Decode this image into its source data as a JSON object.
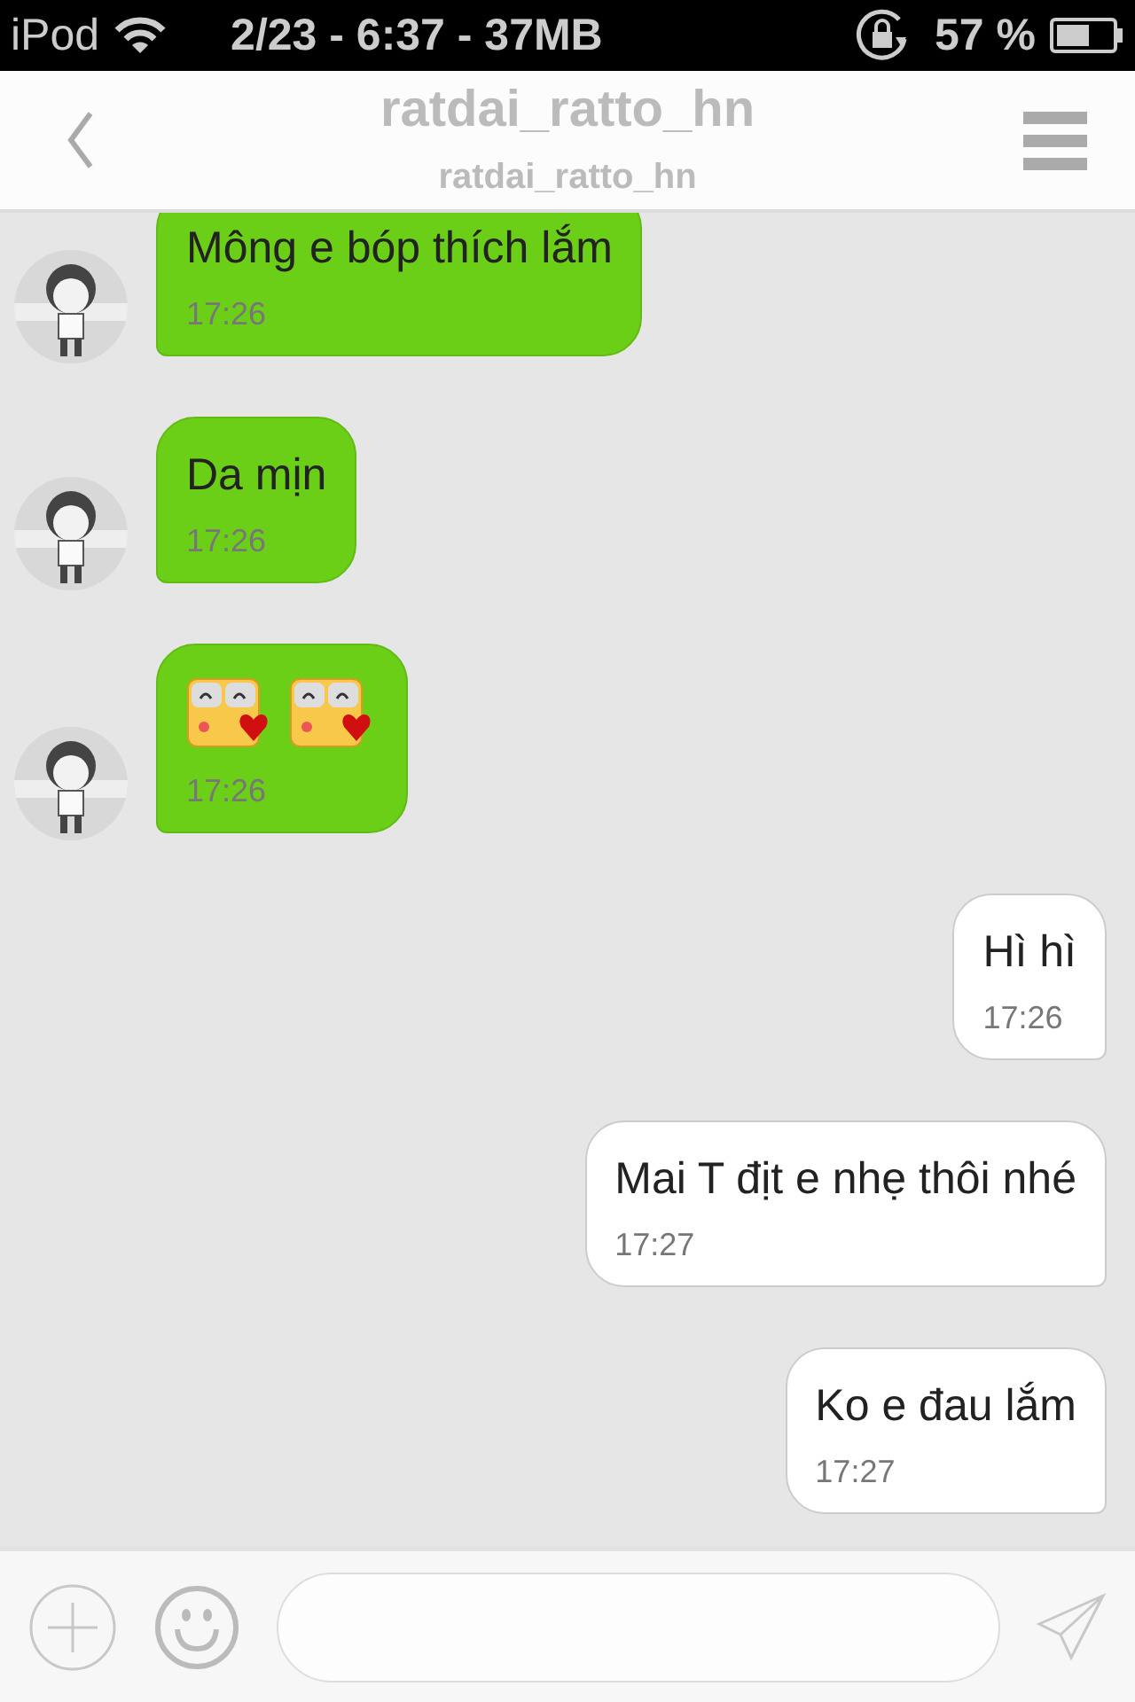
{
  "status_bar": {
    "carrier": "iPod",
    "center": "2/23 - 6:37 - 37MB",
    "battery": "57 %"
  },
  "header": {
    "title": "ratdai_ratto_hn",
    "subtitle": "ratdai_ratto_hn"
  },
  "messages": [
    {
      "outgoing": false,
      "kind": "text",
      "text": "Mông e bóp thích lắm",
      "time": "17:26"
    },
    {
      "outgoing": false,
      "kind": "text",
      "text": "Da mịn",
      "time": "17:26"
    },
    {
      "outgoing": false,
      "kind": "sticker",
      "time": "17:26"
    },
    {
      "outgoing": true,
      "kind": "text",
      "text": "Hì hì",
      "time": "17:26"
    },
    {
      "outgoing": true,
      "kind": "text",
      "text": "Mai T địt e nhẹ thôi nhé",
      "time": "17:27"
    },
    {
      "outgoing": true,
      "kind": "text",
      "text": "Ko e đau lắm",
      "time": "17:27"
    }
  ]
}
